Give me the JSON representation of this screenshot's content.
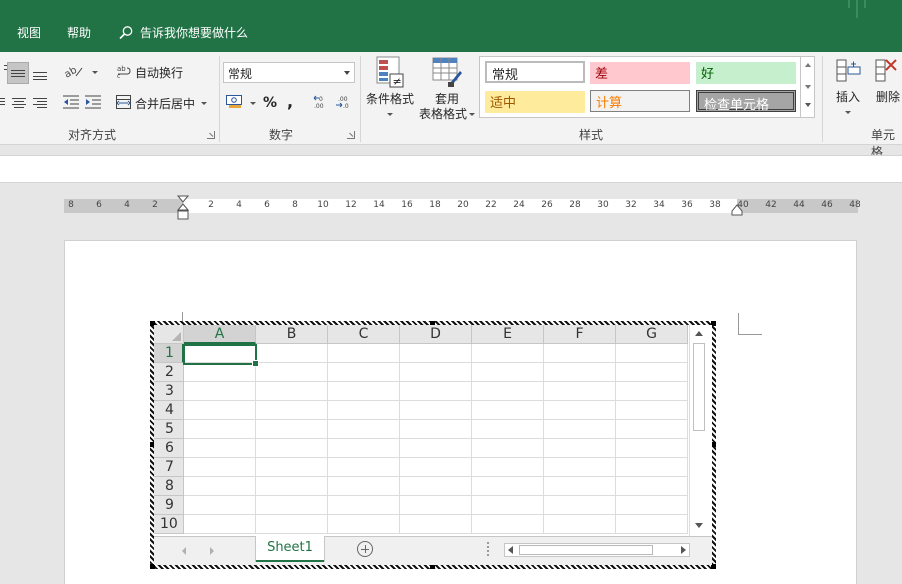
{
  "menu": {
    "tabs": [
      {
        "label": "视图"
      },
      {
        "label": "帮助"
      }
    ],
    "tell_me": "告诉我你想要做什么"
  },
  "ribbon": {
    "alignment": {
      "label": "对齐方式",
      "wrap_text": "自动换行",
      "merge_center": "合并后居中"
    },
    "number": {
      "label": "数字",
      "format_value": "常规",
      "percent_symbol": "%",
      "comma_symbol": ","
    },
    "styles": {
      "label": "样式",
      "conditional_formatting": "条件格式",
      "format_as_table_line1": "套用",
      "format_as_table_line2": "表格格式",
      "gallery": {
        "normal": "常规",
        "bad": "差",
        "good": "好",
        "neutral": "适中",
        "calculation": "计算",
        "check_cell": "检查单元格"
      }
    },
    "cells": {
      "label": "单元格",
      "insert": "插入",
      "delete": "删除"
    }
  },
  "ruler": {
    "left_numbers": [
      "8",
      "6",
      "4",
      "2"
    ],
    "right_numbers": [
      "2",
      "4",
      "6",
      "8",
      "10",
      "12",
      "14",
      "16",
      "18",
      "20",
      "22",
      "24",
      "26",
      "28",
      "30",
      "32",
      "34",
      "36",
      "38",
      "40",
      "42",
      "44",
      "46",
      "48"
    ]
  },
  "sheet": {
    "columns": [
      "A",
      "B",
      "C",
      "D",
      "E",
      "F",
      "G"
    ],
    "rows": [
      "1",
      "2",
      "3",
      "4",
      "5",
      "6",
      "7",
      "8",
      "9",
      "10"
    ],
    "active_cell": "A1",
    "tab_name": "Sheet1"
  },
  "colors": {
    "accent": "#217346",
    "bad_fill": "#ffc7ce",
    "good_fill": "#c6efce",
    "neutral_fill": "#ffeb9c"
  }
}
